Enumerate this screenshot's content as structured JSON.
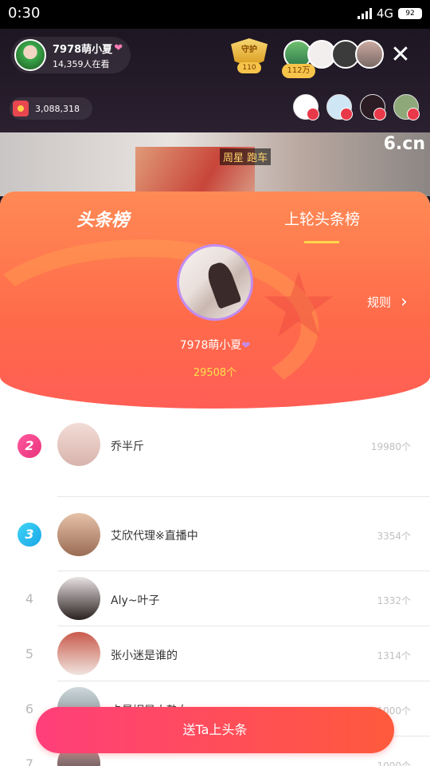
{
  "status": {
    "time": "0:30",
    "network": "4G",
    "battery": "92"
  },
  "host": {
    "name": "7978萌小夏",
    "viewers": "14,359人在看"
  },
  "guard": {
    "label": "守护",
    "level": "110"
  },
  "audience_count": "112万",
  "coins": "3,088,318",
  "video": {
    "caption": "周星 跑车",
    "logo": "6.cn"
  },
  "panel": {
    "tabs": [
      {
        "label": "头条榜"
      },
      {
        "label": "上轮头条榜"
      }
    ],
    "rules_label": "规则",
    "winner": {
      "name": "7978萌小夏",
      "count": "29508个"
    }
  },
  "ranking": [
    {
      "rank": "2",
      "name": "乔半斤",
      "amount": "19980个"
    },
    {
      "rank": "3",
      "name": "艾欣代理※直播中",
      "amount": "3354个"
    },
    {
      "rank": "4",
      "name": "Aly~叶子",
      "amount": "1332个"
    },
    {
      "rank": "5",
      "name": "张小迷是谁的",
      "amount": "1314个"
    },
    {
      "rank": "6",
      "name": "卡曼妮是小熟女",
      "amount": "1000个"
    },
    {
      "rank": "7",
      "name": "",
      "amount": "1000个"
    }
  ],
  "send_button": "送Ta上头条",
  "icons": [
    "heart-icon",
    "close-icon",
    "coin-icon",
    "chevron-right-icon",
    "signal-icon",
    "battery-icon"
  ]
}
